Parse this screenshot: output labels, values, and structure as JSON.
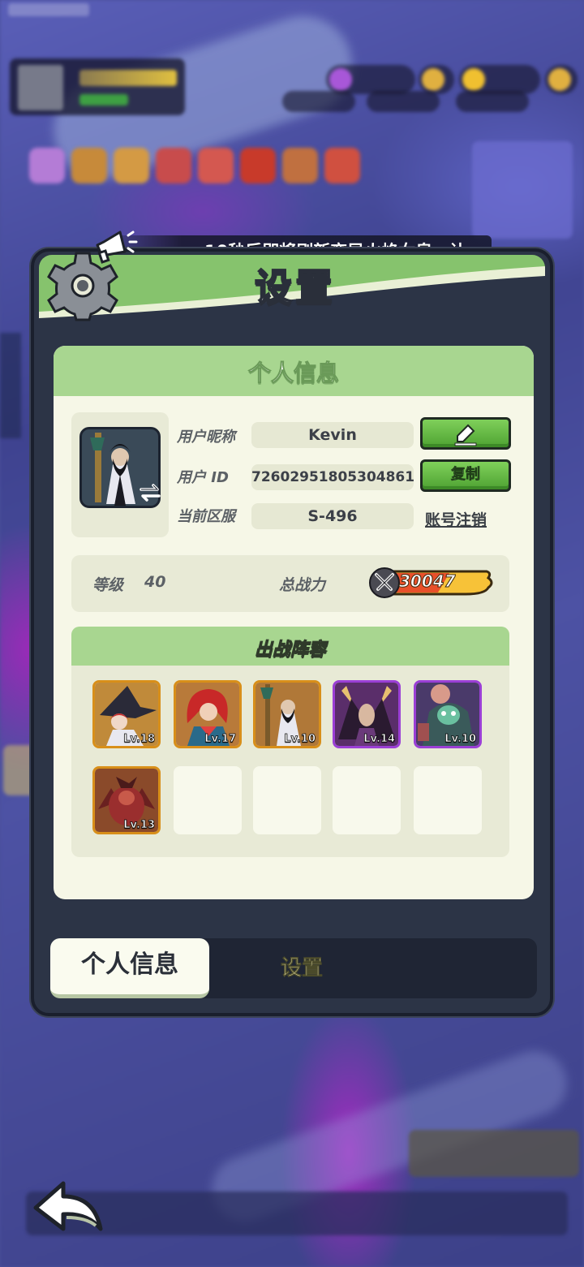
{
  "marquee": {
    "text": "10秒后即将刷新变异火焰女皇，让"
  },
  "dialog": {
    "title": "设置",
    "section_title": "个人信息",
    "profile": {
      "nickname_label": "用户昵称",
      "nickname_value": "Kevin",
      "id_label": "用户  ID",
      "id_value": "72602951805304861",
      "copy_label": "复制",
      "server_label": "当前区服",
      "server_value": "S-496",
      "delete_account_label": "账号注销"
    },
    "stats": {
      "level_label": "等级",
      "level_value": "40",
      "power_label": "总战力",
      "power_value": "30047"
    },
    "lineup": {
      "title": "出战阵容",
      "heroes": [
        {
          "level": "Lv.18",
          "rarity": "gold"
        },
        {
          "level": "Lv.17",
          "rarity": "gold"
        },
        {
          "level": "Lv.10",
          "rarity": "gold"
        },
        {
          "level": "Lv.14",
          "rarity": "purple"
        },
        {
          "level": "Lv.10",
          "rarity": "purple"
        },
        {
          "level": "Lv.13",
          "rarity": "gold"
        }
      ],
      "empty_slots": 4
    },
    "tabs": [
      {
        "label": "个人信息",
        "active": true
      },
      {
        "label": "设置",
        "active": false
      }
    ]
  },
  "icons": {
    "header": "gear-icon",
    "marquee": "megaphone-icon",
    "edit": "pencil-edit-icon",
    "avatar_swap": "swap-arrows-icon",
    "power": "crossed-swords-icon",
    "back": "back-arrow-icon"
  },
  "colors": {
    "header_green": "#86c36d",
    "panel_bg": "#f6f7e7",
    "button_green": "#4ea232",
    "frame_gold": "#d88f1a",
    "frame_purple": "#9b3fd6",
    "power_bar": "#f7c238"
  }
}
